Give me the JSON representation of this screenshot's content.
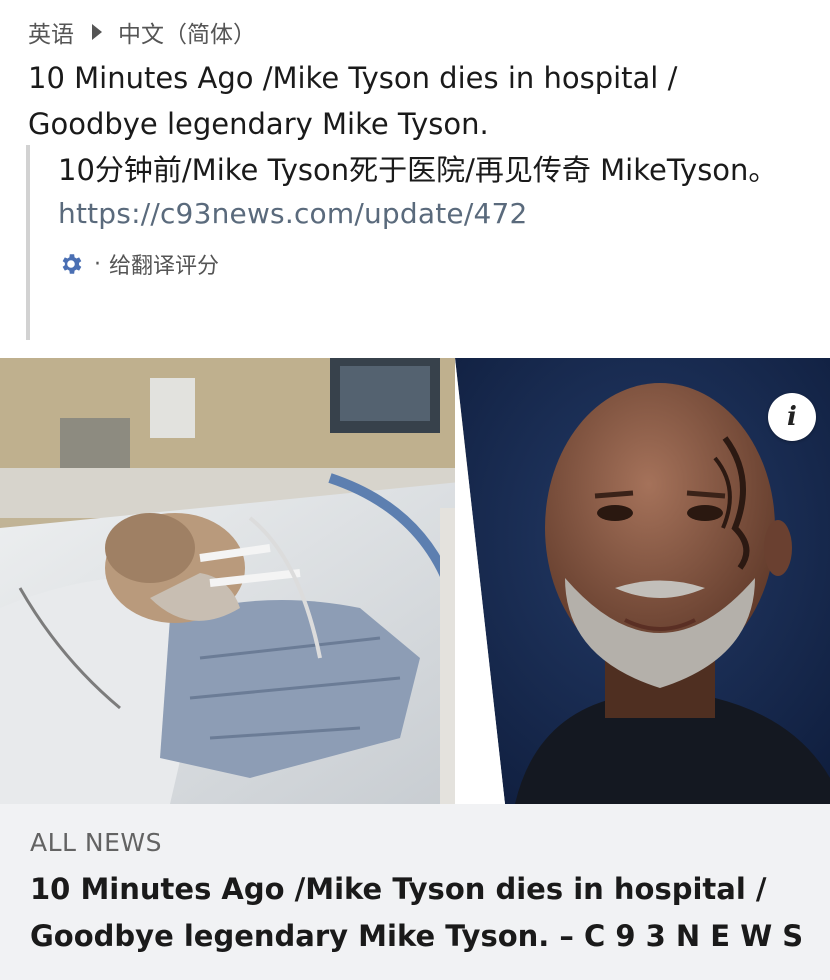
{
  "translation_bar": {
    "source_language": "英语",
    "target_language": "中文（简体）"
  },
  "post": {
    "text": "10 Minutes Ago /Mike Tyson dies in hospital / Goodbye legendary Mike Tyson.",
    "translated_text": "10分钟前/Mike Tyson死于医院/再见传奇 MikeTyson。",
    "link": "https://c93news.com/update/472",
    "rate_translation": "给翻译评分"
  },
  "link_card": {
    "info_icon": "info-icon",
    "source": "ALL NEWS",
    "headline": "10 Minutes Ago /Mike Tyson dies in hospital / Goodbye legendary Mike Tyson. – C 9 3 N E W S"
  },
  "colors": {
    "link": "#5a6a7c",
    "gear": "#4a6fb3",
    "card_background": "#f1f2f4"
  }
}
